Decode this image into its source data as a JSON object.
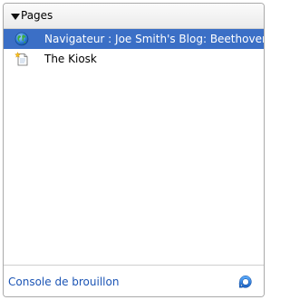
{
  "section": {
    "title": "Pages",
    "expanded": true
  },
  "pages": [
    {
      "label": "Navigateur : Joe Smith's Blog: Beethoven",
      "icon": "globe-icon",
      "selected": true
    },
    {
      "label": "The Kiosk",
      "icon": "new-page-icon",
      "selected": false
    }
  ],
  "footer": {
    "link_label": "Console de brouillon",
    "action_icon": "refresh-icon"
  },
  "colors": {
    "selection": "#3b6fc6",
    "link": "#1c55b5",
    "border": "#a9a9a9"
  }
}
